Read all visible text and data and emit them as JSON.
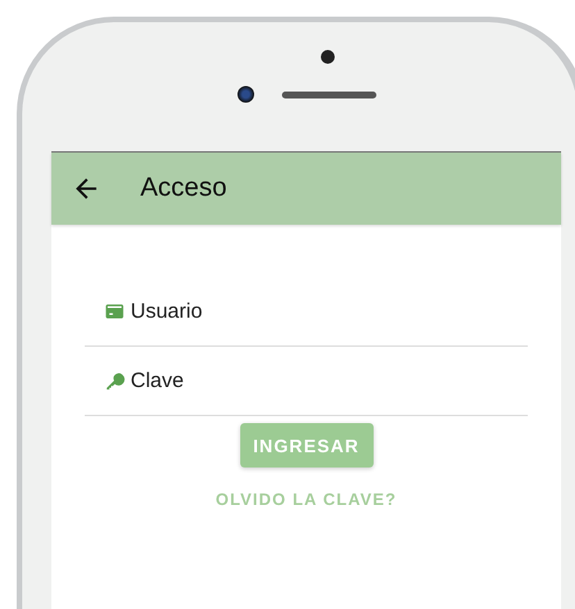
{
  "app_bar": {
    "title": "Acceso"
  },
  "fields": [
    {
      "kind": "user",
      "placeholder": "Usuario"
    },
    {
      "kind": "key",
      "placeholder": "Clave"
    }
  ],
  "submit_button": {
    "label": "INGRESAR"
  },
  "forgot_link": {
    "label": "OLVIDO LA CLAVE?"
  }
}
